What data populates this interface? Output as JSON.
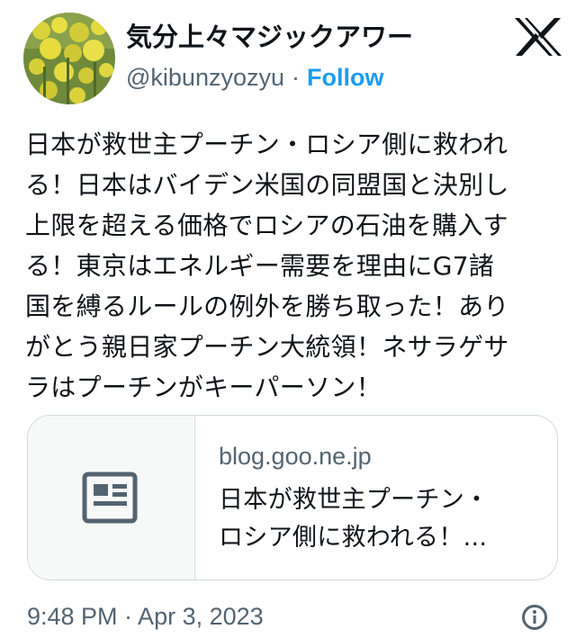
{
  "header": {
    "display_name": "気分上々マジックアワー",
    "handle": "@kibunzyozyu",
    "separator": "·",
    "follow_label": "Follow"
  },
  "tweet": {
    "lines": [
      "日本が救世主プーチン・ロシア側に救われ",
      "る！日本はバイデン米国の同盟国と決別し",
      "上限を超える価格でロシアの石油を購入す",
      "る！東京はエネルギー需要を理由にG7諸",
      "国を縛るルールの例外を勝ち取った！あり",
      "がとう親日家プーチン大統領！ネサラゲサ",
      "ラはプーチンがキーパーソン！"
    ]
  },
  "card": {
    "domain": "blog.goo.ne.jp",
    "title_lines": [
      "日本が救世主プーチン・",
      "ロシア側に救われる！..."
    ]
  },
  "timestamp": "9:48 PM · Apr 3, 2023",
  "icons": {
    "logo": "x-logo-icon",
    "card": "article-icon",
    "info": "info-icon"
  },
  "colors": {
    "accent": "#1d9bf0",
    "text": "#0f1419",
    "secondary": "#536471",
    "border": "#cfd9de"
  }
}
